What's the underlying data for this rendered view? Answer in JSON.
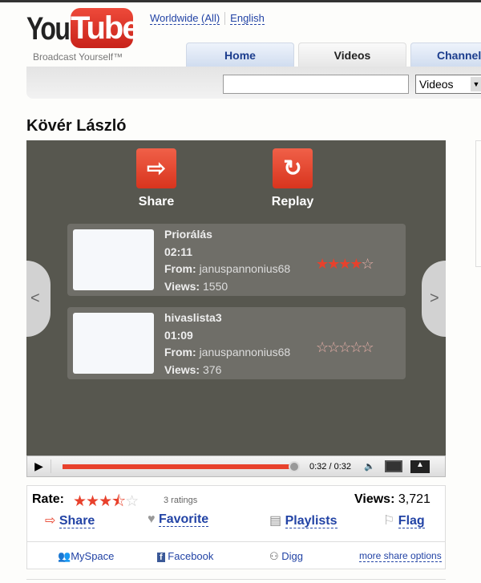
{
  "logo": {
    "you": "You",
    "tube": "Tube",
    "tagline": "Broadcast Yourself™"
  },
  "header": {
    "region": "Worldwide (All)",
    "language": "English",
    "tabs": [
      {
        "label": "Home"
      },
      {
        "label": "Videos"
      },
      {
        "label": "Channels"
      }
    ],
    "search": {
      "value": "",
      "placeholder": ""
    },
    "search_type": "Videos"
  },
  "video": {
    "title": "Kövér László"
  },
  "end_screen": {
    "share": "Share",
    "replay": "Replay",
    "related": [
      {
        "title": "Priorálás",
        "duration": "02:11",
        "from_label": "From:",
        "from": "januspannonius68",
        "views_label": "Views:",
        "views": "1550",
        "rating": 4
      },
      {
        "title": "hivaslista3",
        "duration": "01:09",
        "from_label": "From:",
        "from": "januspannonius68",
        "views_label": "Views:",
        "views": "376",
        "rating": 0
      }
    ]
  },
  "controls": {
    "time": "0:32 / 0:32",
    "progress": 1.0
  },
  "info": {
    "rate_label": "Rate:",
    "rating": 3.5,
    "ratings": "3 ratings",
    "views_label": "Views:",
    "views": "3,721",
    "actions": [
      "Share",
      "Favorite",
      "Playlists",
      "Flag"
    ],
    "share_options": [
      "MySpace",
      "Facebook",
      "Digg"
    ],
    "more": "more share options"
  },
  "colors": {
    "accent": "#e8412c",
    "link": "#2243a5",
    "player_bg": "#57574f"
  }
}
